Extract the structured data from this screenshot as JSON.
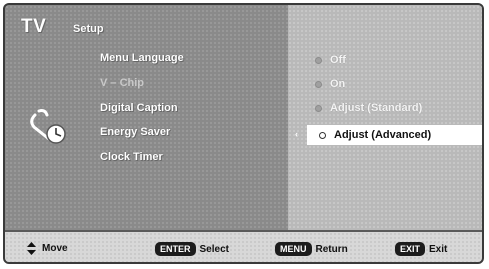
{
  "header": {
    "tv": "TV",
    "section": "Setup"
  },
  "menu": {
    "items": [
      {
        "label": "Menu Language",
        "enabled": true
      },
      {
        "label": "V – Chip",
        "enabled": false
      },
      {
        "label": "Digital Caption",
        "enabled": true
      },
      {
        "label": "Energy Saver",
        "enabled": true
      },
      {
        "label": "Clock Timer",
        "enabled": true
      }
    ]
  },
  "options": {
    "items": [
      {
        "label": "Off"
      },
      {
        "label": "On"
      },
      {
        "label": "Adjust (Standard)"
      },
      {
        "label": "Adjust (Advanced)",
        "selected": true
      }
    ]
  },
  "footer": {
    "move": "Move",
    "enter_key": "ENTER",
    "select": "Select",
    "menu_key": "MENU",
    "return": "Return",
    "exit_key": "EXIT",
    "exit": "Exit"
  },
  "icons": {
    "setup": "setup-wrench-clock-icon",
    "move": "up-down-arrows-icon"
  }
}
